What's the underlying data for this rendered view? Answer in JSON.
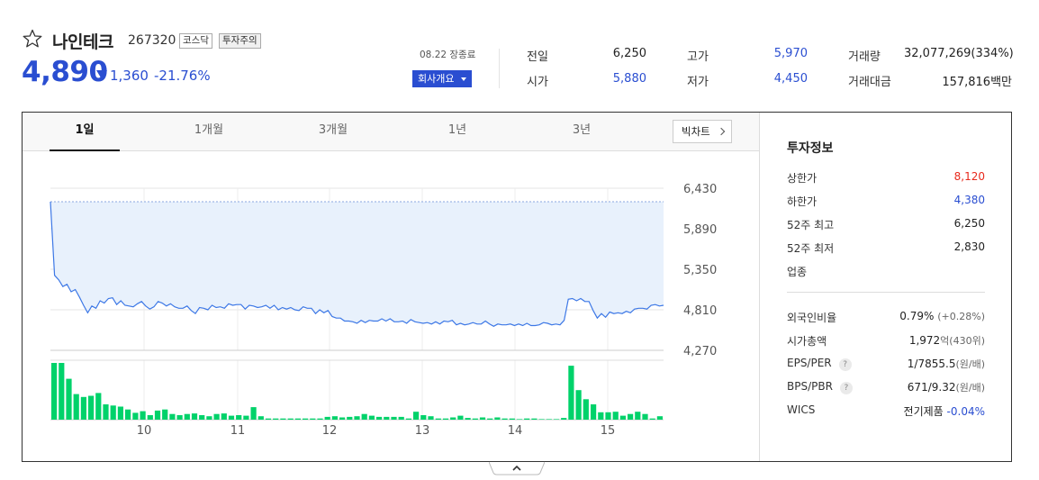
{
  "header": {
    "stock_name": "나인테크",
    "stock_code": "267320",
    "market_badge": "코스닥",
    "warning_badge": "투자주의",
    "price": "4,890",
    "change_amount": "1,360",
    "change_percent": "-21.76%",
    "date_status": "08.22 장종료",
    "company_button": "회사개요",
    "icons": {
      "favorite": "star-outline-icon",
      "down": "triangle-down-icon",
      "dropdown": "caret-down-icon"
    }
  },
  "summary": {
    "prev_close_label": "전일",
    "prev_close": "6,250",
    "open_label": "시가",
    "open": "5,880",
    "high_label": "고가",
    "high": "5,970",
    "low_label": "저가",
    "low": "4,450",
    "volume_label": "거래량",
    "volume": "32,077,269(334%)",
    "trade_value_label": "거래대금",
    "trade_value": "157,816백만"
  },
  "tabs": [
    "1일",
    "1개월",
    "3개월",
    "1년",
    "3년"
  ],
  "active_tab": "1일",
  "bigchart_button": "빅차트",
  "colors": {
    "accent": "#2a4ed1",
    "up": "#e8291c",
    "volume": "#00d26a",
    "area_fill": "#e8f1fc"
  },
  "chart_data": {
    "type": "line",
    "title": "",
    "y_ticks": [
      "6,430",
      "5,890",
      "5,350",
      "4,810",
      "4,270"
    ],
    "ylim": [
      4270,
      6430
    ],
    "x_ticks": [
      "10",
      "11",
      "12",
      "13",
      "14",
      "15"
    ],
    "reference_line": 6250,
    "price_series": [
      6250,
      5270,
      5210,
      5120,
      5150,
      5050,
      5080,
      4980,
      4870,
      4770,
      4860,
      4830,
      4930,
      4900,
      4960,
      4970,
      4880,
      4930,
      4870,
      4860,
      4850,
      4890,
      4920,
      4860,
      4820,
      4850,
      4920,
      4900,
      4860,
      4890,
      4850,
      4830,
      4830,
      4860,
      4800,
      4760,
      4840,
      4830,
      4810,
      4870,
      4840,
      4850,
      4830,
      4890,
      4870,
      4880,
      4880,
      4820,
      4870,
      4860,
      4840,
      4850,
      4870,
      4830,
      4870,
      4810,
      4840,
      4820,
      4840,
      4810,
      4800,
      4850,
      4830,
      4830,
      4760,
      4810,
      4770,
      4800,
      4720,
      4700,
      4700,
      4660,
      4660,
      4650,
      4630,
      4670,
      4640,
      4670,
      4660,
      4660,
      4690,
      4660,
      4690,
      4650,
      4650,
      4660,
      4630,
      4680,
      4650,
      4640,
      4630,
      4640,
      4620,
      4650,
      4620,
      4660,
      4650,
      4670,
      4610,
      4630,
      4610,
      4620,
      4640,
      4620,
      4620,
      4660,
      4620,
      4590,
      4620,
      4610,
      4610,
      4620,
      4600,
      4620,
      4600,
      4630,
      4600,
      4600,
      4610,
      4640,
      4630,
      4610,
      4620,
      4610,
      4670,
      4950,
      4960,
      4930,
      4960,
      4920,
      4920,
      4800,
      4700,
      4760,
      4710,
      4780,
      4760,
      4770,
      4760,
      4790,
      4770,
      4820,
      4830,
      4830,
      4820,
      4870,
      4880,
      4860,
      4870
    ],
    "volume_series": [
      98,
      98,
      68,
      55,
      39,
      39,
      43,
      35,
      27,
      25,
      22,
      18,
      12,
      15,
      10,
      13,
      18,
      17,
      10,
      8,
      6,
      10,
      11,
      7,
      10,
      8,
      8,
      6,
      8,
      10,
      22,
      8,
      6,
      4,
      3,
      3,
      3,
      3,
      3,
      3,
      2,
      4,
      3,
      3,
      3,
      4,
      6,
      6,
      6,
      8,
      6,
      10,
      6,
      4,
      6,
      6,
      4,
      4,
      4,
      6,
      6,
      6,
      4,
      2,
      2,
      2,
      10,
      14,
      8,
      6,
      4,
      4,
      4,
      6,
      6,
      6,
      8,
      6,
      8,
      4,
      4,
      6,
      4,
      6,
      6,
      4,
      4,
      2,
      10,
      4,
      6,
      4,
      4,
      8,
      6,
      4,
      4,
      2,
      4,
      2,
      4,
      4,
      4,
      4,
      4,
      2,
      2,
      6,
      4,
      2,
      2,
      4,
      4,
      4,
      4,
      6,
      8,
      8,
      5,
      4,
      4,
      4,
      22,
      36,
      83,
      54,
      32,
      43,
      34,
      11,
      22,
      13,
      8,
      7,
      9,
      10,
      14,
      11,
      7,
      4,
      6,
      3,
      5,
      8,
      6,
      3,
      5,
      4,
      3
    ],
    "volume_bars": [
      100,
      100,
      72,
      45,
      40,
      42,
      47,
      27,
      25,
      23,
      18,
      12,
      15,
      8,
      16,
      18,
      10,
      8,
      10,
      11,
      8,
      6,
      10,
      11,
      7,
      8,
      7,
      22,
      6,
      2,
      2,
      2,
      2,
      2,
      2,
      2,
      2,
      5,
      6,
      4,
      5,
      6,
      10,
      7,
      5,
      5,
      5,
      5,
      2,
      14,
      8,
      6,
      2,
      2,
      4,
      7,
      3,
      2,
      4,
      2,
      4,
      2,
      2,
      1,
      2,
      2,
      1,
      1,
      1,
      3,
      95,
      52,
      36,
      27,
      13,
      13,
      14,
      7,
      10,
      14,
      10,
      2,
      6
    ]
  },
  "invest_info": {
    "title": "투자정보",
    "upper_limit_label": "상한가",
    "upper_limit": "8,120",
    "lower_limit_label": "하한가",
    "lower_limit": "4,380",
    "high52_label": "52주 최고",
    "high52": "6,250",
    "low52_label": "52주 최저",
    "low52": "2,830",
    "sector_label": "업종",
    "foreign_label": "외국인비율",
    "foreign": "0.79%",
    "foreign_sub": "(+0.28%)",
    "market_cap_label": "시가총액",
    "market_cap": "1,972",
    "market_cap_sub": "억(430위)",
    "eps_per_label": "EPS/PER",
    "eps_per": "1/7855.5",
    "eps_per_sub": "(원/배)",
    "bps_pbr_label": "BPS/PBR",
    "bps_pbr": "671/9.32",
    "bps_pbr_sub": "(원/배)",
    "wics_label": "WICS",
    "wics": "전기제품",
    "wics_change": "-0.04%",
    "help_glyph": "?"
  },
  "collapse_icon": "chevron-up-icon"
}
